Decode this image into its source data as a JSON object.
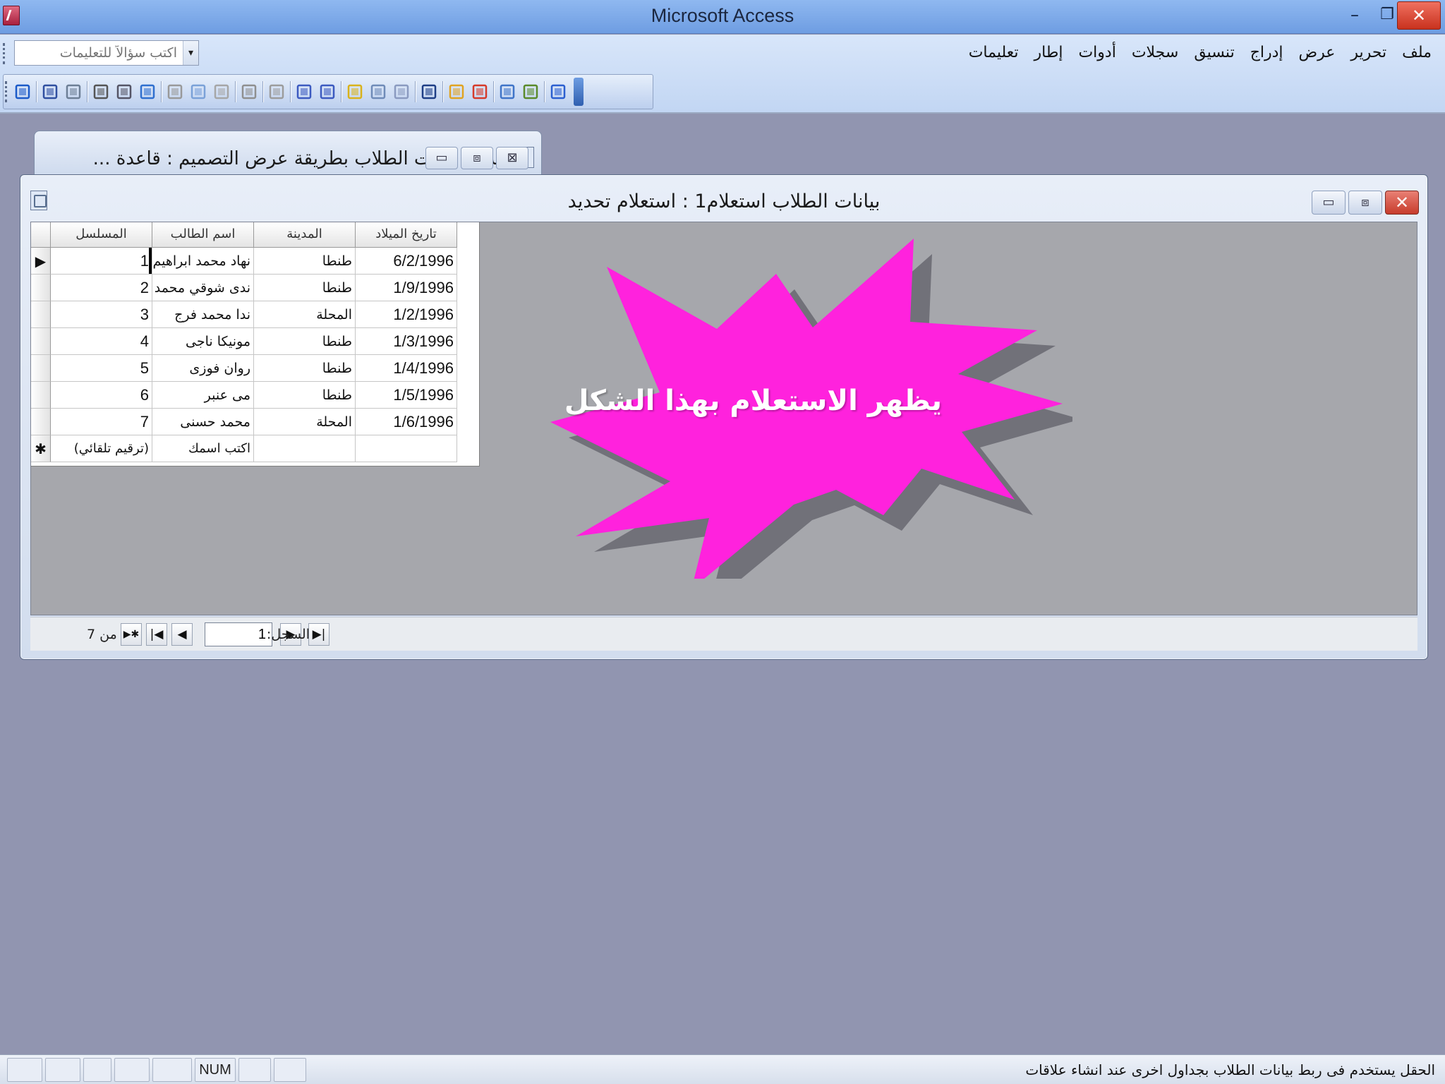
{
  "window": {
    "title": "Microsoft Access",
    "min": "–",
    "max": "❐",
    "close": "✕"
  },
  "menu": {
    "items": [
      "ملف",
      "تحرير",
      "عرض",
      "إدراج",
      "تنسيق",
      "سجلات",
      "أدوات",
      "إطار",
      "تعليمات"
    ]
  },
  "help": {
    "placeholder": "اكتب سؤالاً للتعليمات"
  },
  "toolbar": {
    "icons": [
      "view-icon",
      "save-icon",
      "search-file-icon",
      "print-icon",
      "print-preview-icon",
      "spelling-icon",
      "cut-icon",
      "copy-icon",
      "paste-icon",
      "undo-icon",
      "hyperlink-icon",
      "sort-ascending-icon",
      "sort-descending-icon",
      "filter-by-selection-icon",
      "filter-by-form-icon",
      "apply-filter-icon",
      "find-icon",
      "new-record-icon",
      "delete-record-icon",
      "database-window-icon",
      "new-object-icon",
      "help-icon"
    ]
  },
  "bg_window": {
    "title": "جدول بيانات الطلاب بطريقة عرض التصميم : قاعدة ..."
  },
  "query_window": {
    "title": "بيانات الطلاب استعلام1 : استعلام تحديد"
  },
  "grid": {
    "columns": [
      "المسلسل",
      "اسم الطالب",
      "المدينة",
      "تاريخ الميلاد"
    ],
    "rows": [
      [
        "1",
        "نهاد محمد ابراهيم",
        "طنطا",
        "6/2/1996"
      ],
      [
        "2",
        "ندى شوقي محمد على",
        "طنطا",
        "1/9/1996"
      ],
      [
        "3",
        "ندا محمد فرج",
        "المحلة",
        "1/2/1996"
      ],
      [
        "4",
        "مونيكا ناجى",
        "طنطا",
        "1/3/1996"
      ],
      [
        "5",
        "روان فوزى",
        "طنطا",
        "1/4/1996"
      ],
      [
        "6",
        "مى عنبر",
        "طنطا",
        "1/5/1996"
      ],
      [
        "7",
        "محمد حسنى",
        "المحلة",
        "1/6/1996"
      ]
    ],
    "new_row": [
      "(ترقيم تلقائي)",
      "اكتب اسمك",
      "",
      ""
    ],
    "current_selector": "▶",
    "new_selector": "✱"
  },
  "callout": {
    "text": "يظهر الاستعلام بهذا الشكل",
    "color": "#ff22dd"
  },
  "navigation": {
    "label": "السجل:",
    "current": "1",
    "of_text": "من 7",
    "first": "|◀",
    "prev": "◀",
    "next": "▶",
    "last": "▶|",
    "new": "▶✱"
  },
  "status": {
    "text": "الحقل يستخدم فى ربط بيانات الطلاب بجداول اخرى عند انشاء علاقات",
    "num": "NUM"
  }
}
